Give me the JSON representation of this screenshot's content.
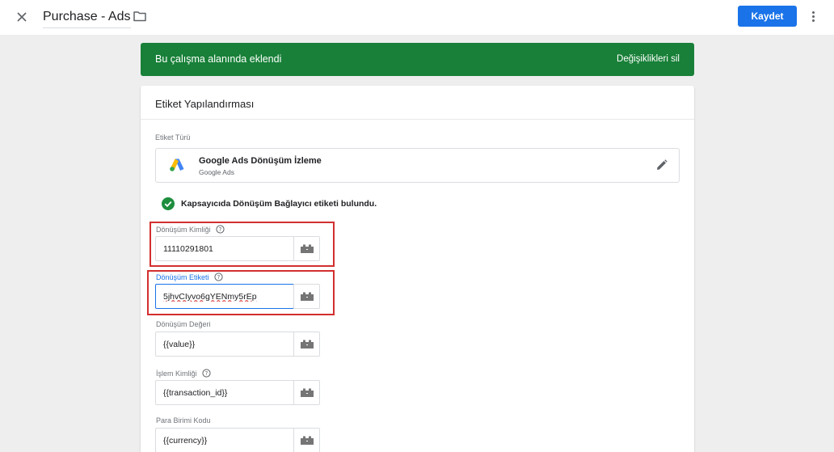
{
  "header": {
    "title": "Purchase - Ads",
    "save_label": "Kaydet"
  },
  "banner": {
    "text": "Bu çalışma alanında eklendi",
    "action": "Değişiklikleri sil",
    "color": "#188038"
  },
  "card": {
    "title": "Etiket Yapılandırması",
    "tag_type_label": "Etiket Türü",
    "tag_type": {
      "name": "Google Ads Dönüşüm İzleme",
      "subtitle": "Google Ads"
    },
    "linker_message": "Kapsayıcıda Dönüşüm Bağlayıcı etiketi bulundu.",
    "fields": [
      {
        "label": "Dönüşüm Kimliği",
        "value": "11110291801",
        "help": true
      },
      {
        "label": "Dönüşüm Etiketi",
        "value": "5jhvCIyvo6gYENmy5rEp",
        "help": true
      },
      {
        "label": "Dönüşüm Değeri",
        "value": "{{value}}",
        "help": false
      },
      {
        "label": "İşlem Kimliği",
        "value": "{{transaction_id}}",
        "help": true
      },
      {
        "label": "Para Birimi Kodu",
        "value": "{{currency}}",
        "help": false
      }
    ]
  },
  "colors": {
    "accent": "#1a73e8",
    "highlight": "#d32f2f",
    "success": "#188038"
  }
}
